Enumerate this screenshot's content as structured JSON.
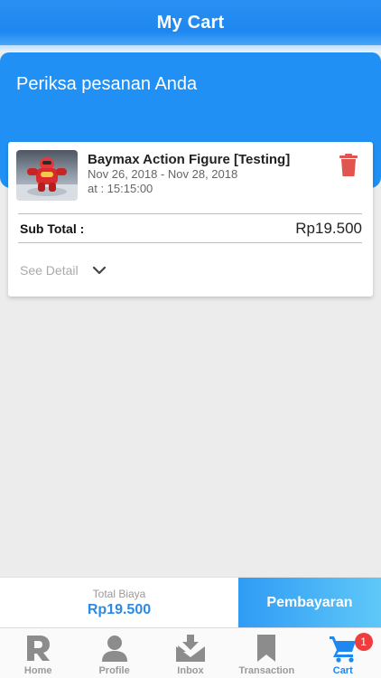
{
  "header": {
    "title": "My Cart"
  },
  "banner": {
    "text": "Periksa pesanan Anda"
  },
  "cart_item": {
    "title": "Baymax Action Figure [Testing]",
    "dates": "Nov 26, 2018 - Nov 28, 2018",
    "time": "at : 15:15:00",
    "sub_total_label": "Sub Total :",
    "sub_total_value": "Rp19.500",
    "see_detail_label": "See Detail",
    "delete_icon": "trash-icon",
    "delete_color": "#e0554f"
  },
  "checkout": {
    "total_label": "Total Biaya",
    "total_value": "Rp19.500",
    "pay_label": "Pembayaran"
  },
  "tabbar": {
    "tabs": [
      {
        "label": "Home",
        "icon": "home-logo-icon"
      },
      {
        "label": "Profile",
        "icon": "person-icon"
      },
      {
        "label": "Inbox",
        "icon": "inbox-icon"
      },
      {
        "label": "Transaction",
        "icon": "bookmark-icon"
      },
      {
        "label": "Cart",
        "icon": "cart-icon",
        "active": true,
        "badge": "1"
      }
    ]
  },
  "colors": {
    "primary": "#1e88f0",
    "badge": "#f03c3c",
    "total_value": "#2a8ae8"
  }
}
